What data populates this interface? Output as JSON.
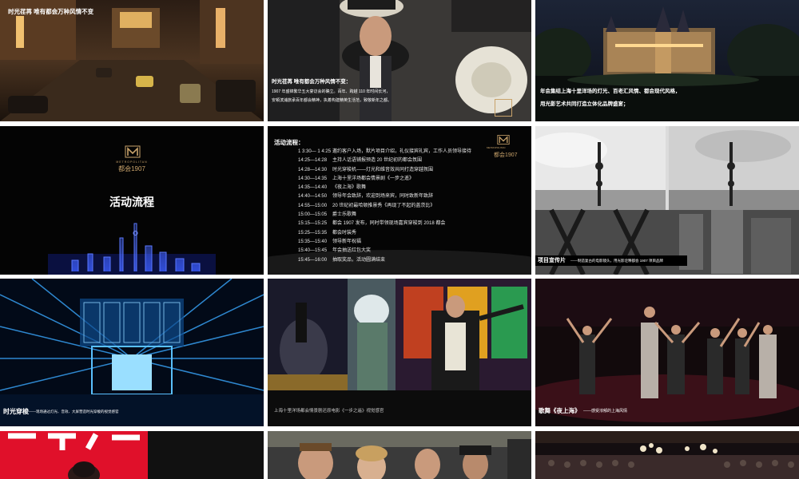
{
  "slides": {
    "s1": {
      "title": "时光荏苒 唯有都会万种风情不变"
    },
    "s2": {
      "title": "时光荏苒 唯有都会万种风情不变：",
      "line1": "1907 年盛锦繁华五大宴访会的确立。百年、跨越 110 年时间长河，",
      "line2": "安顿滨浦旅承百年都会精神，执着构建精英生活范，致敬新年之都。"
    },
    "s3": {
      "line1": "年会集结上海十里洋场的灯光、百老汇风情、都会现代风格，",
      "line2": "用光影艺术共同打造立体化品牌盛宴；"
    },
    "s4": {
      "logo_text": "都会1907",
      "logo_sub": "METROPOLITAN",
      "title": "活动流程"
    },
    "s5": {
      "heading": "活动流程：",
      "logo_text": "都会1907",
      "logo_sub": "METROPOLITAN",
      "schedule": [
        {
          "time": "1 3:30— 1 4:25",
          "item": "邀约客户入场，默片项目介绍，礼仪接宾礼宾，工作人员领导接待"
        },
        {
          "time": "14:25—14:28",
          "item": "主持人话语铺报预造 20 世纪初的都会氛围"
        },
        {
          "time": "14:28—14:30",
          "item": "时光穿梭机——灯光和维音效共同打造穿越氛围"
        },
        {
          "time": "14:30—14:35",
          "item": "上海十里洋场都会情景剧《一步之遥》"
        },
        {
          "time": "14:35—14:40",
          "item": "《夜上海》歌舞"
        },
        {
          "time": "14:40—14:50",
          "item": "领导年会致辞，欢迎到场来宾，同时致新年致辞"
        },
        {
          "time": "14:55—15:00",
          "item": "20 世纪初最哈顿推景秀《再现了不起的盖茨比》"
        },
        {
          "time": "15:00—15:05",
          "item": "爵士乐歌舞"
        },
        {
          "time": "15:15—15:25",
          "item": "都会 1907 发布，同时带领现场嘉宾穿梭到 2018 都会"
        },
        {
          "time": "15:25—15:35",
          "item": "都会时装秀"
        },
        {
          "time": "15:35—15:40",
          "item": "领导新年祝福"
        },
        {
          "time": "15:40—15:45",
          "item": "年会抽送红包大奖"
        },
        {
          "time": "15:45—16:00",
          "item": "抽取奖品，活动圆满结束"
        }
      ]
    },
    "s6": {
      "title": "项目宣传片",
      "desc": "——制造复古的电影镜头，用光影诠释都会 1907 项目品牌"
    },
    "s7": {
      "title": "时光穿梭",
      "desc": "——现场通过灯光、音效、大屏营造时光穿梭的视觉感官"
    },
    "s8": {
      "caption": "上海十里洋场都会情景剧还原电影《一步之遥》视觉感官"
    },
    "s9": {
      "title": "歌舞《夜上海》",
      "desc": "——感受浓郁的上海风情"
    }
  },
  "colors": {
    "gold": "#c8a26a",
    "neon_blue": "#3aa8ff",
    "red": "#e0102a"
  }
}
